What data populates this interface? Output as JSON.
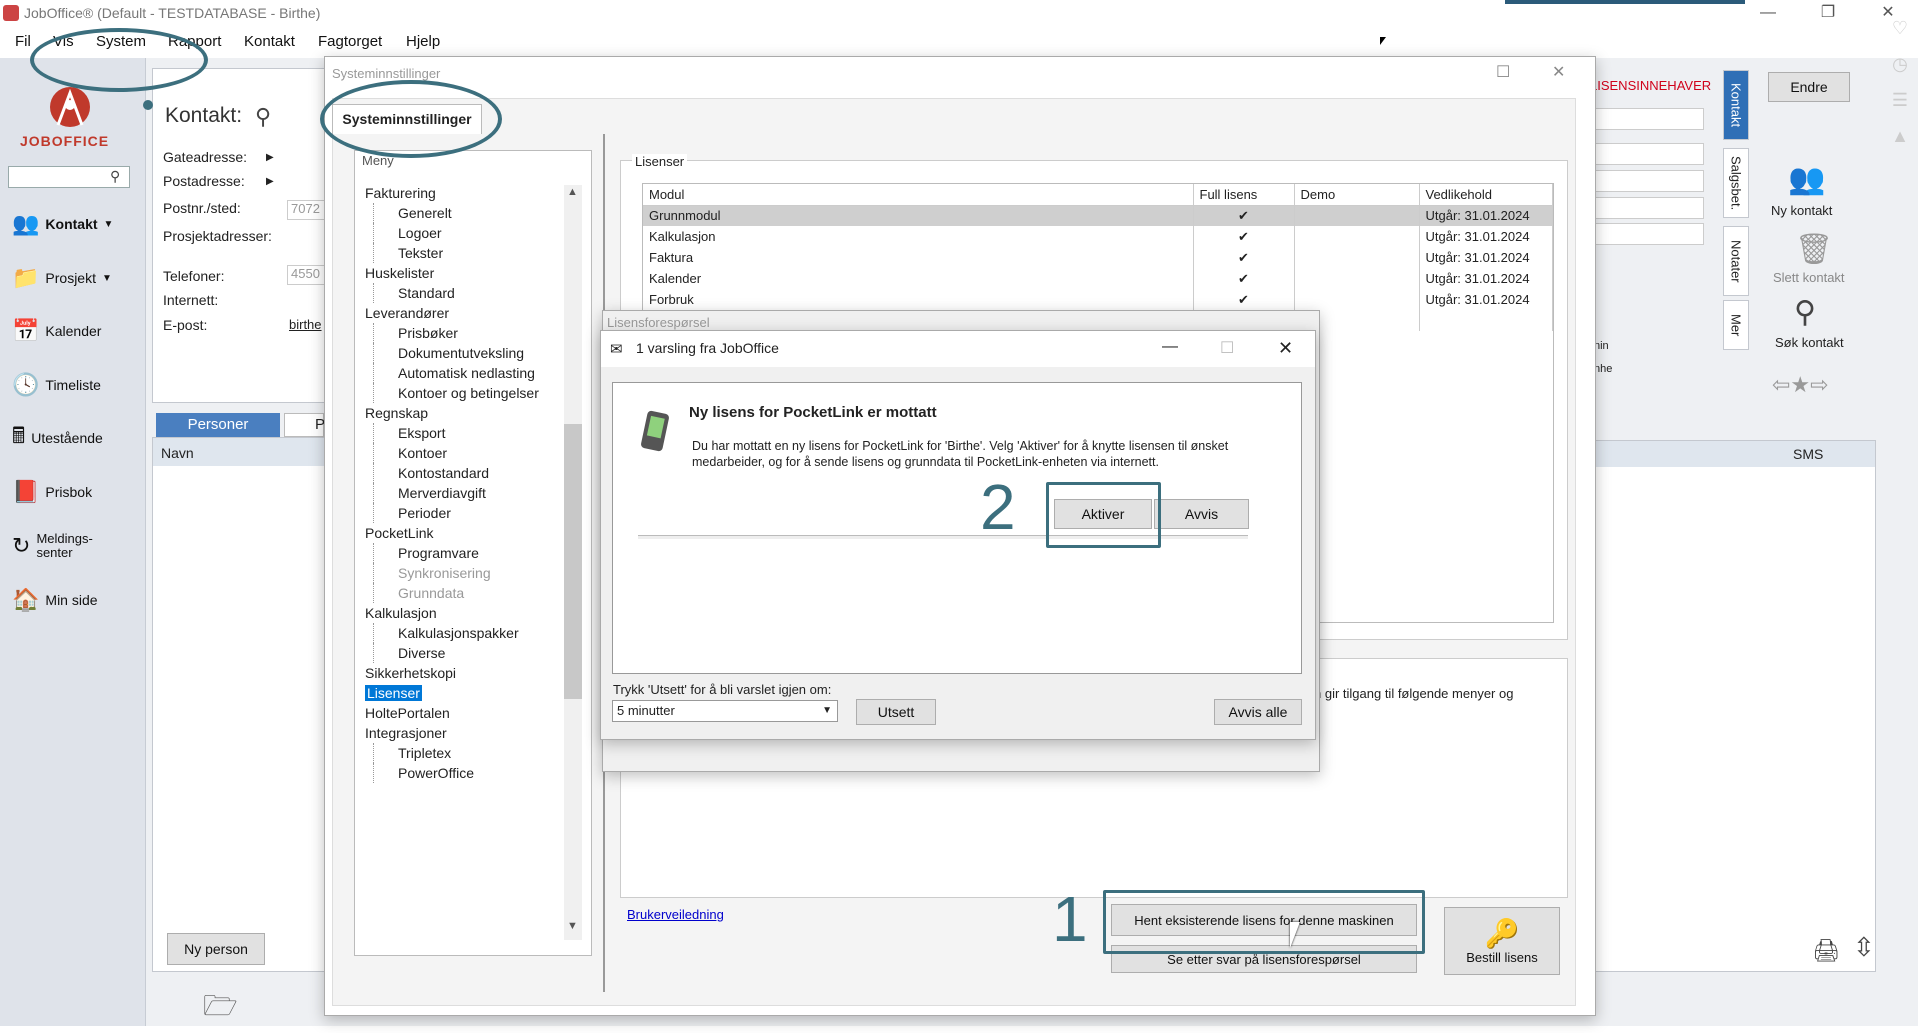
{
  "window": {
    "title": "JobOffice®   (Default - TESTDATABASE - Birthe)"
  },
  "menubar": [
    "Fil",
    "Vis",
    "System",
    "Rapport",
    "Kontakt",
    "Fagtorget",
    "Hjelp"
  ],
  "logo": {
    "text": "JOBOFFICE"
  },
  "leftnav": [
    "Kontakt",
    "Prosjekt",
    "Kalender",
    "Timeliste",
    "Utestående",
    "Prisbok",
    "Meldings-\nsenter",
    "Min side"
  ],
  "contact": {
    "title": "Kontakt:",
    "fields": [
      "Gateadresse:",
      "Postadresse:",
      "Postnr./sted:",
      "Prosjektadresser:",
      "Telefoner:",
      "Internett:",
      "E-post:"
    ],
    "values": {
      "postnr": "7072",
      "telefon": "4550",
      "epost": "birthe"
    },
    "tabs": [
      "Personer",
      "P"
    ],
    "col_navn": "Navn",
    "col_sms": "SMS",
    "new_person": "Ny person",
    "licensee_label": "LISENSINNEHAVER",
    "edit_btn": "Endre",
    "side_tabs": [
      "Kontakt",
      "Salgsbet.",
      "Notater",
      "Mer"
    ],
    "side_actions": [
      "Ny kontakt",
      "Slett kontakt",
      "Søk kontakt"
    ],
    "small_text": [
      "nin",
      "nhe"
    ]
  },
  "settings": {
    "title": "Systeminnstillinger",
    "tab": "Systeminnstillinger",
    "menu_label": "Meny",
    "tree": [
      {
        "label": "Fakturering",
        "level": 1
      },
      {
        "label": "Generelt",
        "level": 2
      },
      {
        "label": "Logoer",
        "level": 2
      },
      {
        "label": "Tekster",
        "level": 2
      },
      {
        "label": "Huskelister",
        "level": 1
      },
      {
        "label": "Standard",
        "level": 2
      },
      {
        "label": "Leverandører",
        "level": 1
      },
      {
        "label": "Prisbøker",
        "level": 2
      },
      {
        "label": "Dokumentutveksling",
        "level": 2
      },
      {
        "label": "Automatisk nedlasting",
        "level": 2
      },
      {
        "label": "Kontoer og betingelser",
        "level": 2
      },
      {
        "label": "Regnskap",
        "level": 1
      },
      {
        "label": "Eksport",
        "level": 2
      },
      {
        "label": "Kontoer",
        "level": 2
      },
      {
        "label": "Kontostandard",
        "level": 2
      },
      {
        "label": "Merverdiavgift",
        "level": 2
      },
      {
        "label": "Perioder",
        "level": 2
      },
      {
        "label": "PocketLink",
        "level": 1
      },
      {
        "label": "Programvare",
        "level": 2
      },
      {
        "label": "Synkronisering",
        "level": 2,
        "dim": true
      },
      {
        "label": "Grunndata",
        "level": 2,
        "dim": true
      },
      {
        "label": "Kalkulasjon",
        "level": 1
      },
      {
        "label": "Kalkulasjonspakker",
        "level": 2
      },
      {
        "label": "Diverse",
        "level": 2
      },
      {
        "label": "Sikkerhetskopi",
        "level": 1
      },
      {
        "label": "Lisenser",
        "level": 1,
        "selected": true
      },
      {
        "label": "HoltePortalen",
        "level": 1
      },
      {
        "label": "Integrasjoner",
        "level": 1
      },
      {
        "label": "Tripletex",
        "level": 2
      },
      {
        "label": "PowerOffice",
        "level": 2
      }
    ],
    "licenses_group": "Lisenser",
    "columns": [
      "Modul",
      "Full lisens",
      "Demo",
      "Vedlikehold"
    ],
    "rows": [
      {
        "modul": "Grunnmodul",
        "full": "✔",
        "demo": "",
        "vedlikehold": "Utgår: 31.01.2024"
      },
      {
        "modul": "Kalkulasjon",
        "full": "✔",
        "demo": "",
        "vedlikehold": "Utgår: 31.01.2024"
      },
      {
        "modul": "Faktura",
        "full": "✔",
        "demo": "",
        "vedlikehold": "Utgår: 31.01.2024"
      },
      {
        "modul": "Kalender",
        "full": "✔",
        "demo": "",
        "vedlikehold": "Utgår: 31.01.2024"
      },
      {
        "modul": "Forbruk",
        "full": "✔",
        "demo": "",
        "vedlikehold": "Utgår: 31.01.2024"
      }
    ],
    "info_text": "n gir tilgang til følgende menyer og",
    "help_link": "Brukerveiledning",
    "btn_fetch": "Hent eksisterende lisens for denne maskinen",
    "btn_check": "Se etter svar på lisensforespørsel",
    "btn_order": "Bestill lisens"
  },
  "request_window": {
    "title": "Lisensforespørsel"
  },
  "notification": {
    "title": "1 varsling fra JobOffice",
    "heading": "Ny lisens for PocketLink er mottatt",
    "body": "Du har mottatt en ny lisens for PocketLink for 'Birthe'. Velg 'Aktiver' for å knytte lisensen til ønsket medarbeider, og for å sende lisens og grunndata til PocketLink-enheten via internett.",
    "btn_activate": "Aktiver",
    "btn_reject": "Avvis",
    "snooze_label": "Trykk 'Utsett' for å bli varslet igjen om:",
    "snooze_value": "5 minutter",
    "btn_snooze": "Utsett",
    "btn_reject_all": "Avvis alle"
  },
  "annotations": {
    "step1": "1",
    "step2": "2"
  },
  "colors": {
    "annotation": "#3c6f7e",
    "selection": "#0078d7",
    "accent_tab": "#2f6fb6",
    "licensee": "#d0021b"
  }
}
